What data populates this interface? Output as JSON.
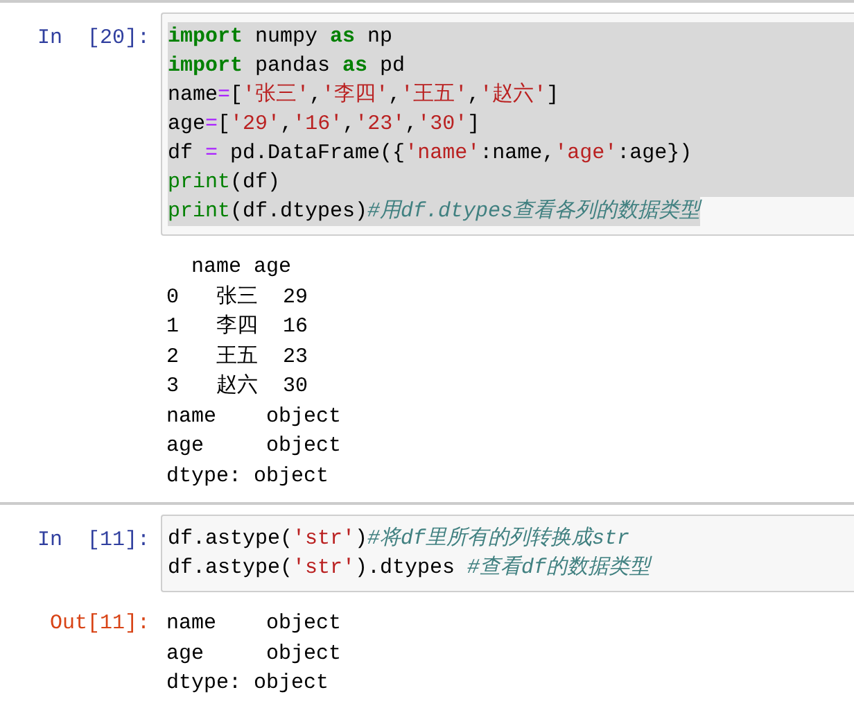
{
  "cells": [
    {
      "kind": "input",
      "prompt": "In  [20]:",
      "code": [
        {
          "selected": true,
          "tokens": [
            {
              "kind": "keyword",
              "text": "import"
            },
            {
              "kind": "plain",
              "text": " numpy "
            },
            {
              "kind": "keyword",
              "text": "as"
            },
            {
              "kind": "plain",
              "text": " np"
            }
          ]
        },
        {
          "selected": true,
          "tokens": [
            {
              "kind": "keyword",
              "text": "import"
            },
            {
              "kind": "plain",
              "text": " pandas "
            },
            {
              "kind": "keyword",
              "text": "as"
            },
            {
              "kind": "plain",
              "text": " pd"
            }
          ]
        },
        {
          "selected": true,
          "tokens": [
            {
              "kind": "plain",
              "text": "name"
            },
            {
              "kind": "operator",
              "text": "="
            },
            {
              "kind": "plain",
              "text": "["
            },
            {
              "kind": "string",
              "text": "'张三'"
            },
            {
              "kind": "plain",
              "text": ","
            },
            {
              "kind": "string",
              "text": "'李四'"
            },
            {
              "kind": "plain",
              "text": ","
            },
            {
              "kind": "string",
              "text": "'王五'"
            },
            {
              "kind": "plain",
              "text": ","
            },
            {
              "kind": "string",
              "text": "'赵六'"
            },
            {
              "kind": "plain",
              "text": "]"
            }
          ]
        },
        {
          "selected": true,
          "tokens": [
            {
              "kind": "plain",
              "text": "age"
            },
            {
              "kind": "operator",
              "text": "="
            },
            {
              "kind": "plain",
              "text": "["
            },
            {
              "kind": "string",
              "text": "'29'"
            },
            {
              "kind": "plain",
              "text": ","
            },
            {
              "kind": "string",
              "text": "'16'"
            },
            {
              "kind": "plain",
              "text": ","
            },
            {
              "kind": "string",
              "text": "'23'"
            },
            {
              "kind": "plain",
              "text": ","
            },
            {
              "kind": "string",
              "text": "'30'"
            },
            {
              "kind": "plain",
              "text": "]"
            }
          ]
        },
        {
          "selected": true,
          "tokens": [
            {
              "kind": "plain",
              "text": "df "
            },
            {
              "kind": "operator",
              "text": "="
            },
            {
              "kind": "plain",
              "text": " pd.DataFrame({"
            },
            {
              "kind": "string",
              "text": "'name'"
            },
            {
              "kind": "plain",
              "text": ":name,"
            },
            {
              "kind": "string",
              "text": "'age'"
            },
            {
              "kind": "plain",
              "text": ":age})"
            }
          ]
        },
        {
          "selected": true,
          "tokens": [
            {
              "kind": "builtin",
              "text": "print"
            },
            {
              "kind": "plain",
              "text": "(df)"
            }
          ]
        },
        {
          "selected": true,
          "tokens": [
            {
              "kind": "builtin",
              "text": "print"
            },
            {
              "kind": "plain",
              "text": "(df.dtypes)"
            },
            {
              "kind": "comment",
              "text": "#用df.dtypes查看各列的数据类型"
            }
          ]
        }
      ],
      "output": [
        "  name age",
        "0   张三  29",
        "1   李四  16",
        "2   王五  23",
        "3   赵六  30",
        "name    object",
        "age     object",
        "dtype: object"
      ]
    },
    {
      "kind": "input",
      "prompt": "In  [11]:",
      "code": [
        {
          "selected": false,
          "tokens": [
            {
              "kind": "plain",
              "text": "df.astype("
            },
            {
              "kind": "string",
              "text": "'str'"
            },
            {
              "kind": "plain",
              "text": ")"
            },
            {
              "kind": "comment",
              "text": "#将df里所有的列转换成str"
            }
          ]
        },
        {
          "selected": false,
          "tokens": [
            {
              "kind": "plain",
              "text": "df.astype("
            },
            {
              "kind": "string",
              "text": "'str'"
            },
            {
              "kind": "plain",
              "text": ").dtypes "
            },
            {
              "kind": "comment",
              "text": "#查看df的数据类型"
            }
          ]
        }
      ],
      "output_prompt": "Out[11]:",
      "output": [
        "name    object",
        "age     object",
        "dtype: object"
      ]
    }
  ]
}
